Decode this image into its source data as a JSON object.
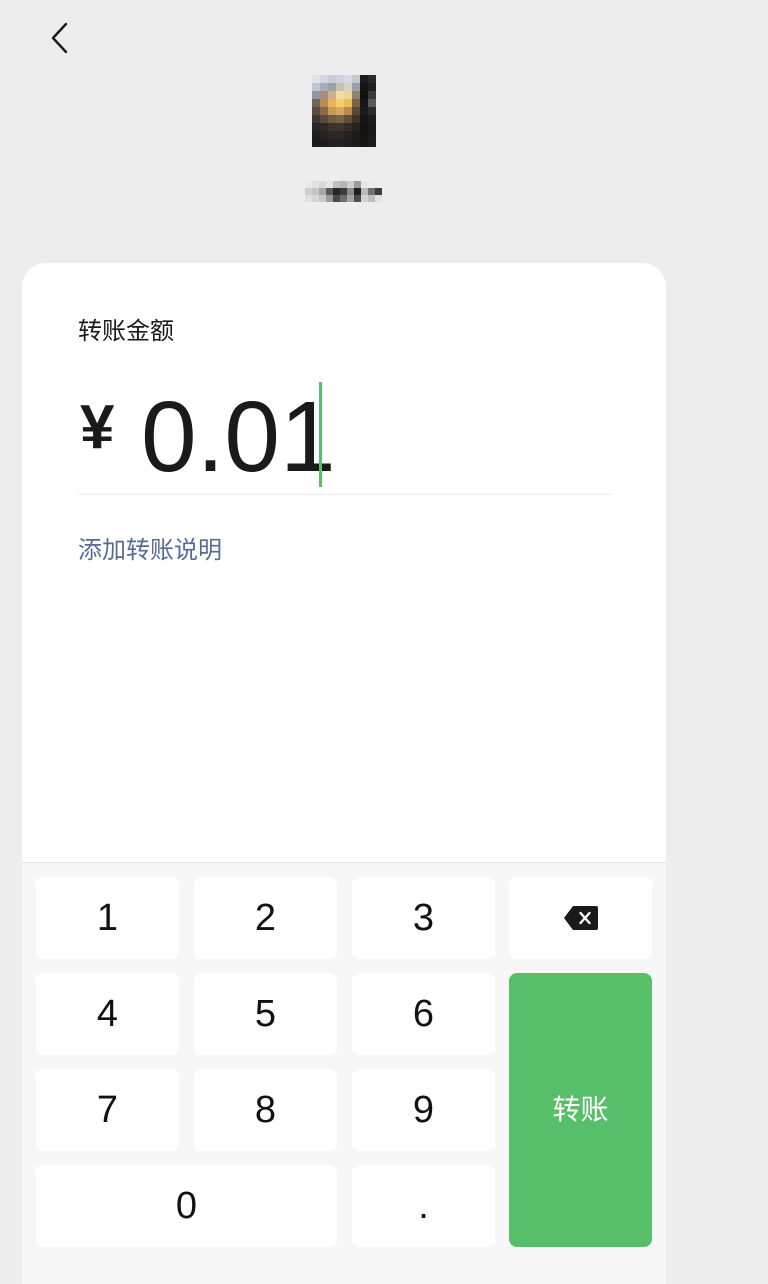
{
  "colors": {
    "page_background": "#ededed",
    "accent": "#57be6a",
    "link": "#576b95"
  },
  "header": {
    "back_icon": "chevron-left-icon"
  },
  "amount_card": {
    "label": "转账金额",
    "currency_symbol": "¥",
    "amount": "0.01",
    "add_note_link": "添加转账说明"
  },
  "keypad": {
    "keys": [
      "1",
      "2",
      "3",
      "4",
      "5",
      "6",
      "7",
      "8",
      "9",
      "0",
      "."
    ],
    "delete_icon": "backspace-icon",
    "submit_label": "转账"
  }
}
